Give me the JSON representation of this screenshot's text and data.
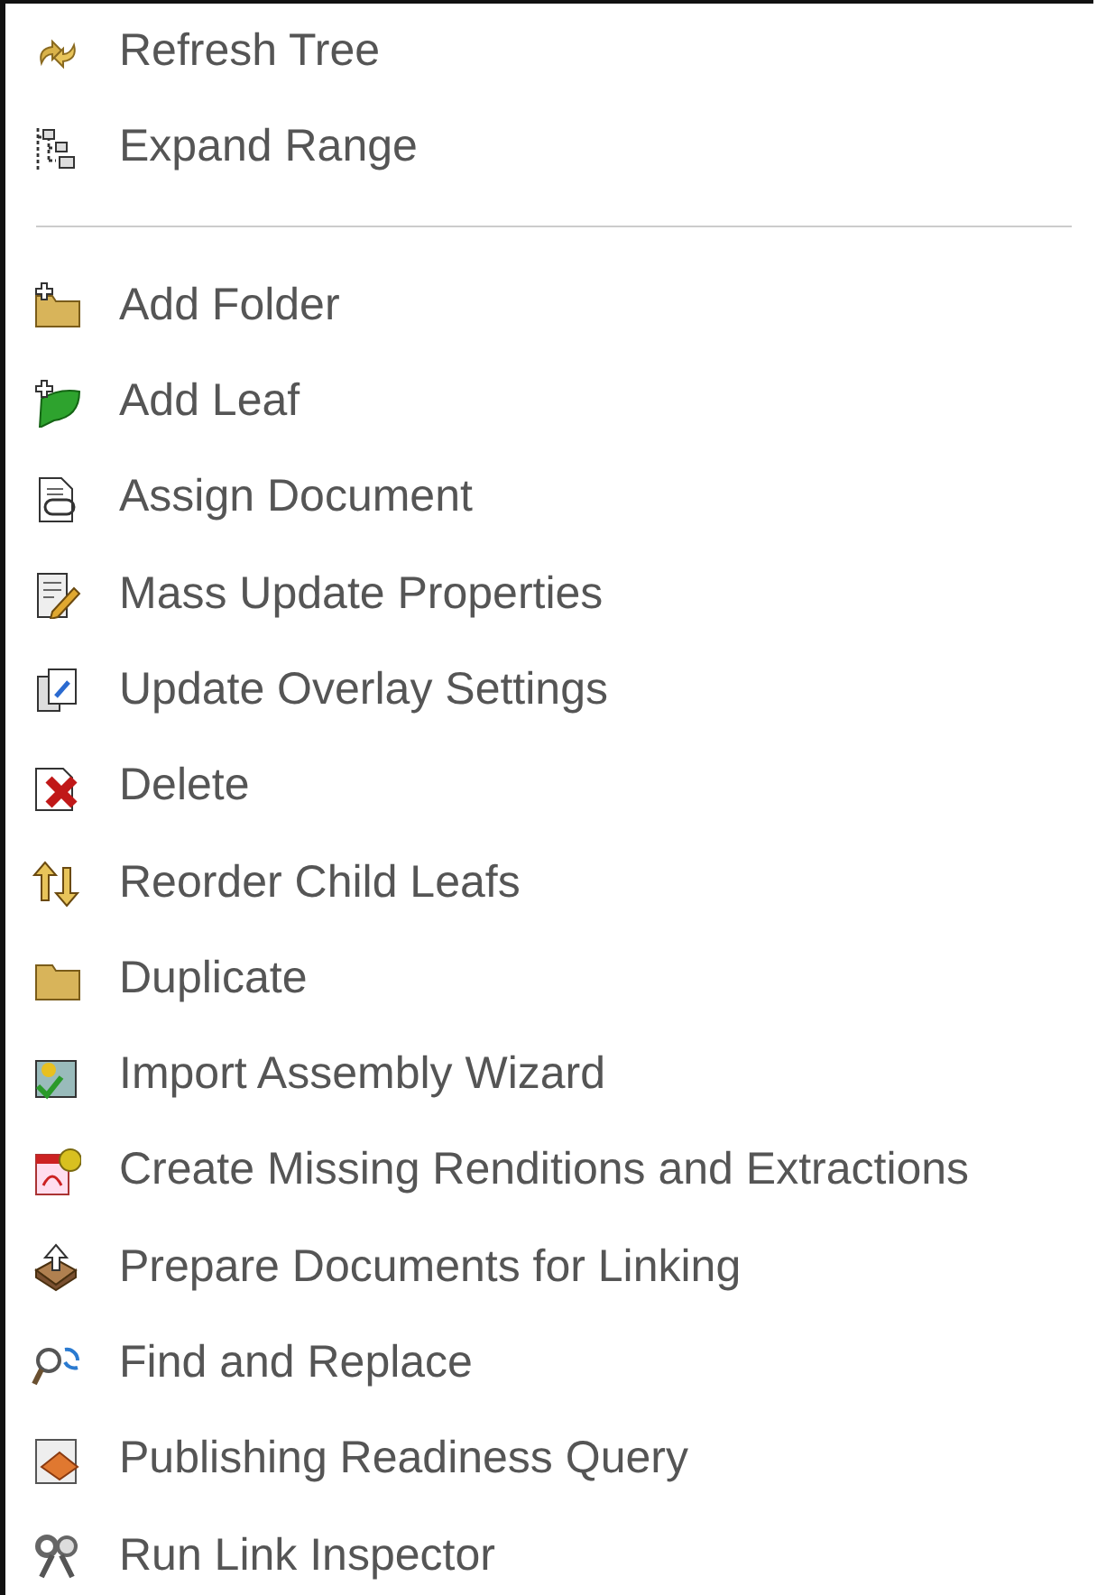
{
  "menu": {
    "groups": [
      {
        "items": [
          {
            "label": "Refresh Tree"
          },
          {
            "label": "Expand Range"
          }
        ]
      },
      {
        "items": [
          {
            "label": "Add Folder"
          },
          {
            "label": "Add Leaf"
          },
          {
            "label": "Assign Document"
          },
          {
            "label": "Mass Update Properties"
          },
          {
            "label": "Update Overlay Settings"
          },
          {
            "label": "Delete"
          },
          {
            "label": "Reorder Child Leafs"
          },
          {
            "label": "Duplicate"
          },
          {
            "label": "Import Assembly Wizard"
          },
          {
            "label": "Create Missing Renditions and Extractions"
          },
          {
            "label": "Prepare Documents for Linking"
          },
          {
            "label": "Find and Replace"
          },
          {
            "label": "Publishing Readiness Query"
          },
          {
            "label": "Run Link Inspector"
          }
        ]
      }
    ]
  }
}
